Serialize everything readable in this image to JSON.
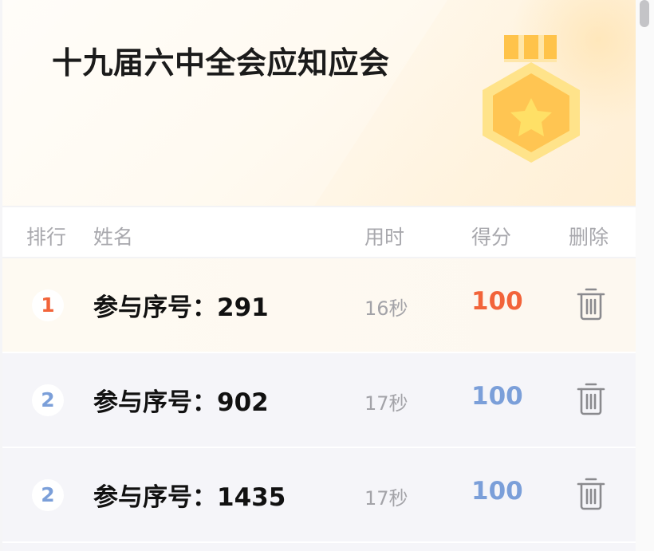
{
  "header": {
    "title": "十九届六中全会应知应会",
    "medal_icon": "medal-star-icon"
  },
  "columns": {
    "rank": "排行",
    "name": "姓名",
    "time": "用时",
    "score": "得分",
    "delete": "删除"
  },
  "rows": [
    {
      "rank": "1",
      "name": "参与序号：291",
      "time": "16秒",
      "score": "100"
    },
    {
      "rank": "2",
      "name": "参与序号：902",
      "time": "17秒",
      "score": "100"
    },
    {
      "rank": "2",
      "name": "参与序号：1435",
      "time": "17秒",
      "score": "100"
    }
  ],
  "colors": {
    "first_rank": "#f2643a",
    "other_rank": "#7b9fd9",
    "first_score": "#f2643a",
    "other_score": "#7b9fd9",
    "medal": "#ffc34a"
  }
}
